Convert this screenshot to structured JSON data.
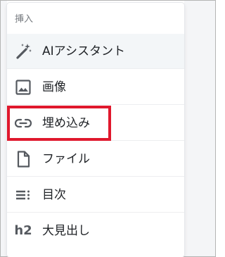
{
  "menu": {
    "header": "挿入",
    "items": [
      {
        "label": "AIアシスタント",
        "icon": "magic-wand-icon"
      },
      {
        "label": "画像",
        "icon": "image-icon"
      },
      {
        "label": "埋め込み",
        "icon": "link-icon"
      },
      {
        "label": "ファイル",
        "icon": "file-icon"
      },
      {
        "label": "目次",
        "icon": "table-of-contents-icon"
      },
      {
        "label": "大見出し",
        "icon": "heading-h2-icon",
        "icon_text": "h2"
      }
    ]
  },
  "colors": {
    "highlight": "#e0182d",
    "icon": "#55595f",
    "active_bg": "#f3f6f8"
  }
}
